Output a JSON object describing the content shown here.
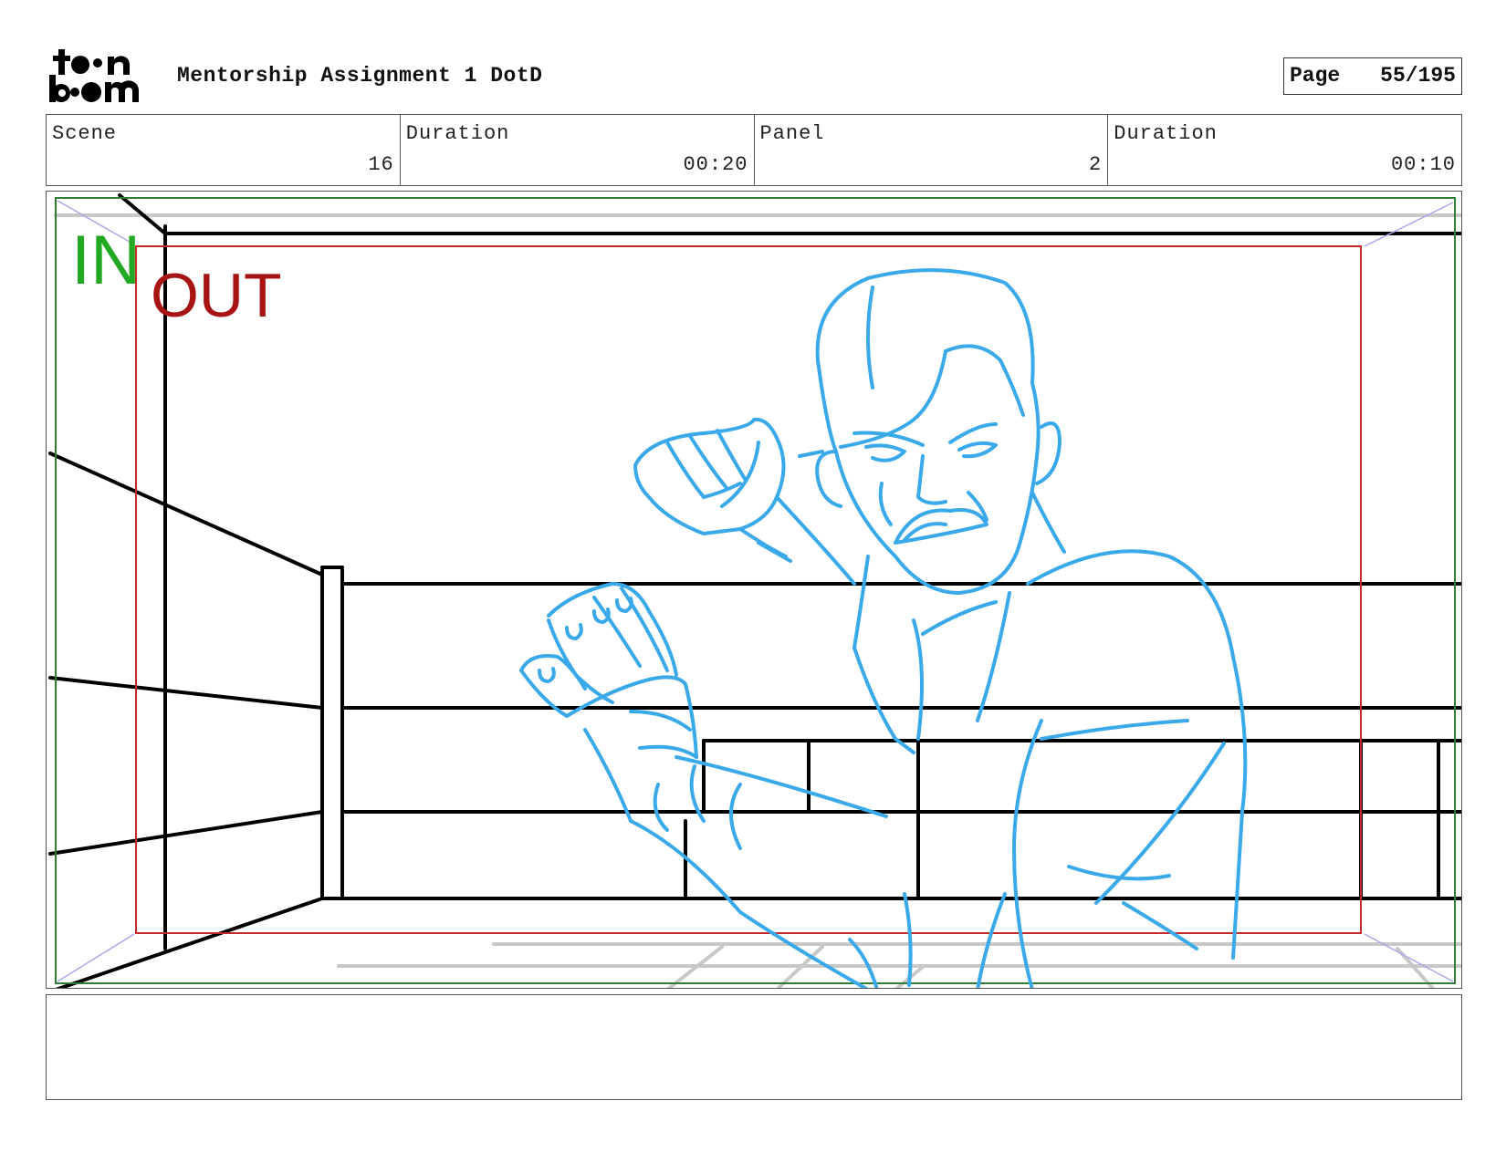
{
  "header": {
    "logo_text_top": "toon",
    "logo_text_bottom": "boom",
    "title": "Mentorship Assignment 1 DotD",
    "page_label": "Page",
    "page_value": "55/195"
  },
  "info": {
    "scene_label": "Scene",
    "scene_value": "16",
    "scene_duration_label": "Duration",
    "scene_duration_value": "00:20",
    "panel_label": "Panel",
    "panel_value": "2",
    "panel_duration_label": "Duration",
    "panel_duration_value": "00:10"
  },
  "panel": {
    "in_marker": "IN",
    "out_marker": "OUT",
    "colors": {
      "sketch": "#3aa9ea",
      "in_frame": "#2e7d32",
      "out_frame": "#c62828",
      "ink": "#000000"
    }
  },
  "notes": {
    "text": ""
  }
}
